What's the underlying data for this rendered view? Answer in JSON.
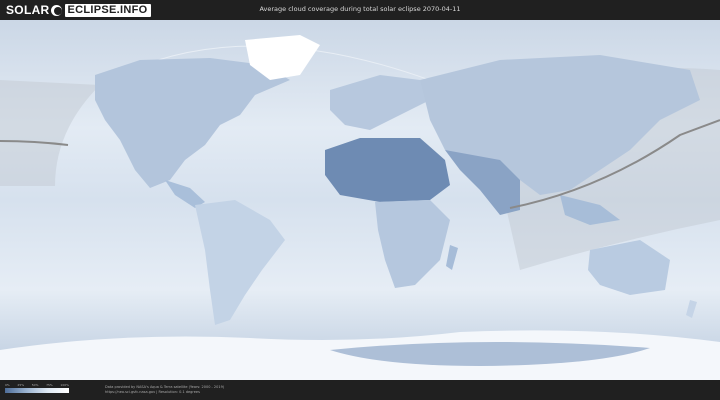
{
  "header": {
    "logo_part1": "SOLAR",
    "logo_part2": "ECLIPSE.INFO",
    "title": "Average cloud coverage during total solar eclipse 2070-04-11"
  },
  "map": {
    "description_icon": "world-cloud-coverage-map",
    "colors": {
      "ocean_clear": "#eef3f9",
      "land_cloudy": "#b9c9de",
      "land_clear": "#5f7ea8",
      "path": "#8a8a8a",
      "night_shade": "#c9d0d8"
    }
  },
  "legend": {
    "ticks": [
      "0%",
      "25%",
      "50%",
      "75%",
      "100%"
    ],
    "colors": [
      "#4e6d98",
      "#9ab3d0",
      "#dfe9f4",
      "#ffffff"
    ]
  },
  "footer": {
    "credit_line1": "Data provided by NASA's Aqua & Terra satellite (Years: 2000 - 2019)",
    "credit_line2": "https://neo.sci.gsfc.nasa.gov | Resolution: 0.1 degrees"
  }
}
